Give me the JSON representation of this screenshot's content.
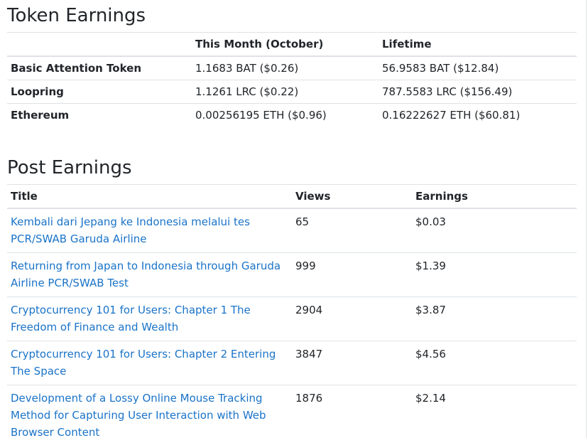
{
  "token_section": {
    "title": "Token Earnings",
    "headers": [
      "",
      "This Month (October)",
      "Lifetime"
    ],
    "rows": [
      {
        "token": "Basic Attention Token",
        "month": "1.1683 BAT ($0.26)",
        "lifetime": "56.9583 BAT ($12.84)"
      },
      {
        "token": "Loopring",
        "month": "1.1261 LRC ($0.22)",
        "lifetime": "787.5583 LRC ($156.49)"
      },
      {
        "token": "Ethereum",
        "month": "0.00256195 ETH ($0.96)",
        "lifetime": "0.16222627 ETH ($60.81)"
      }
    ]
  },
  "post_section": {
    "title": "Post Earnings",
    "headers": [
      "Title",
      "Views",
      "Earnings"
    ],
    "rows": [
      {
        "title": "Kembali dari Jepang ke Indonesia melalui tes PCR/SWAB Garuda Airline",
        "views": "65",
        "earnings": "$0.03"
      },
      {
        "title": "Returning from Japan to Indonesia through Garuda Airline PCR/SWAB Test",
        "views": "999",
        "earnings": "$1.39"
      },
      {
        "title": "Cryptocurrency 101 for Users: Chapter 1 The Freedom of Finance and Wealth",
        "views": "2904",
        "earnings": "$3.87"
      },
      {
        "title": "Cryptocurrency 101 for Users: Chapter 2 Entering The Space",
        "views": "3847",
        "earnings": "$4.56"
      },
      {
        "title": "Development of a Lossy Online Mouse Tracking Method for Capturing User Interaction with Web Browser Content",
        "views": "1876",
        "earnings": "$2.14"
      }
    ]
  },
  "colors": {
    "link": "#1a73c8",
    "border": "#dee2e6",
    "text": "#212529"
  }
}
